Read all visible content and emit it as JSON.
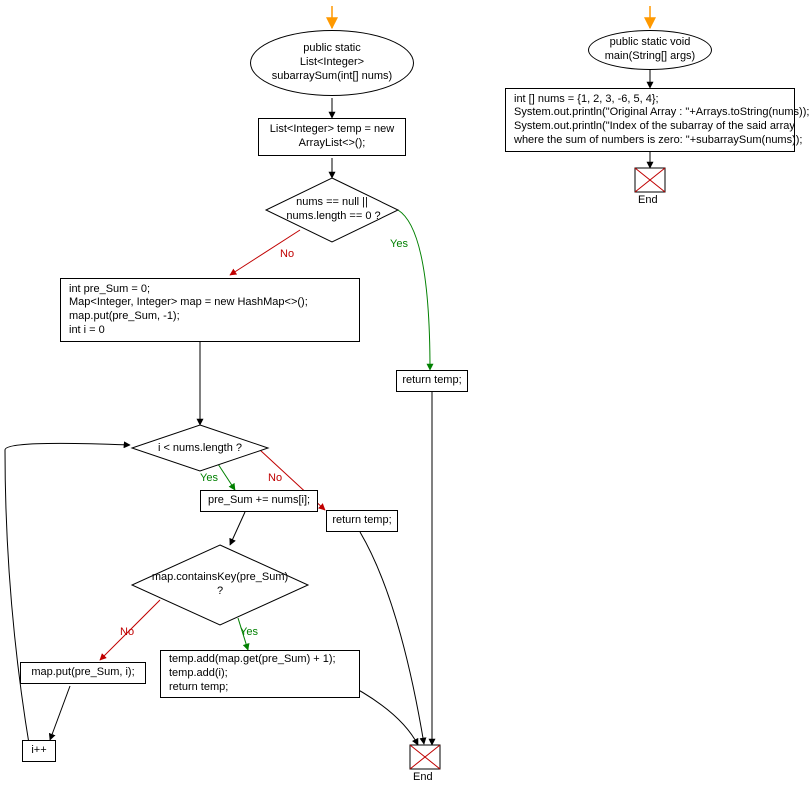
{
  "chart_data": {
    "type": "flowchart",
    "functions": [
      {
        "name": "subarraySum",
        "signature": "public static\nList<Integer>\nsubarraySum(int[] nums)",
        "nodes": [
          {
            "id": "n1",
            "kind": "process",
            "text": "List<Integer> temp = new\nArrayList<>();"
          },
          {
            "id": "d1",
            "kind": "decision",
            "text": "nums == null ||\nnums.length == 0 ?",
            "yes": "r1",
            "no": "n2"
          },
          {
            "id": "r1",
            "kind": "process",
            "text": "return temp;"
          },
          {
            "id": "n2",
            "kind": "process",
            "text": "int pre_Sum = 0;\nMap<Integer, Integer> map = new HashMap<>();\nmap.put(pre_Sum, -1);\nint i = 0"
          },
          {
            "id": "d2",
            "kind": "decision",
            "text": "i < nums.length ?",
            "yes": "n3",
            "no": "r2"
          },
          {
            "id": "n3",
            "kind": "process",
            "text": "pre_Sum += nums[i];"
          },
          {
            "id": "r2",
            "kind": "process",
            "text": "return temp;"
          },
          {
            "id": "d3",
            "kind": "decision",
            "text": "map.containsKey(pre_Sum)\n?",
            "yes": "n4",
            "no": "n5"
          },
          {
            "id": "n4",
            "kind": "process",
            "text": "temp.add(map.get(pre_Sum) + 1);\ntemp.add(i);\nreturn temp;"
          },
          {
            "id": "n5",
            "kind": "process",
            "text": "map.put(pre_Sum, i);"
          },
          {
            "id": "n6",
            "kind": "process",
            "text": "i++"
          }
        ],
        "end": "End"
      },
      {
        "name": "main",
        "signature": "public static void\nmain(String[] args)",
        "nodes": [
          {
            "id": "m1",
            "kind": "process",
            "text": "int [] nums = {1, 2, 3, -6, 5, 4};\nSystem.out.println(\"Original Array : \"+Arrays.toString(nums));\nSystem.out.println(\"Index of the subarray of the said array\nwhere the sum of numbers is zero: \"+subarraySum(nums));"
          }
        ],
        "end": "End"
      }
    ]
  },
  "labels": {
    "yes": "Yes",
    "no": "No"
  },
  "f1": {
    "sig": "public static\nList<Integer>\nsubarraySum(int[] nums)",
    "n1": "List<Integer> temp = new\nArrayList<>();",
    "d1": "nums == null ||\n nums.length == 0 ?",
    "r1": "return temp;",
    "n2": "int pre_Sum = 0;\nMap<Integer, Integer> map = new HashMap<>();\nmap.put(pre_Sum, -1);\nint i = 0",
    "d2": "i < nums.length ?",
    "n3": "pre_Sum += nums[i];",
    "r2": "return temp;",
    "d3": "map.containsKey(pre_Sum)\n?",
    "n4": "temp.add(map.get(pre_Sum) + 1);\ntemp.add(i);\nreturn temp;",
    "n5": "map.put(pre_Sum, i);",
    "n6": "i++",
    "end": "End"
  },
  "f2": {
    "sig": "public static void\nmain(String[] args)",
    "m1": "int [] nums = {1, 2, 3, -6, 5, 4};\nSystem.out.println(\"Original Array : \"+Arrays.toString(nums));\nSystem.out.println(\"Index of the subarray of the said array\nwhere the sum of numbers is zero: \"+subarraySum(nums));",
    "end": "End"
  }
}
